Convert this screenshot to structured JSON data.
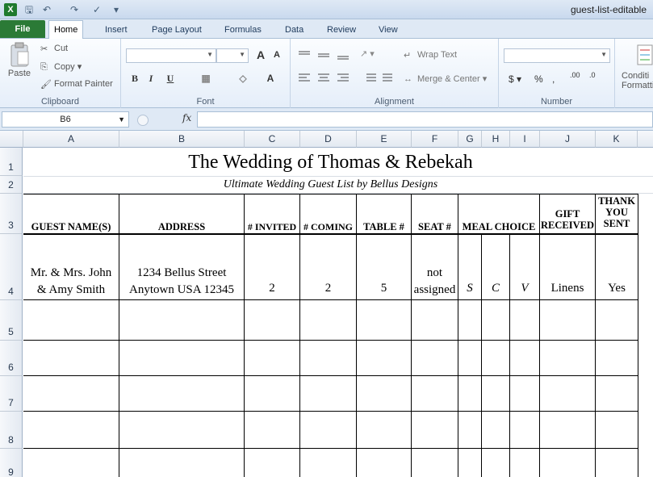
{
  "window": {
    "app_icon": "X",
    "title": "guest-list-editable",
    "quick_access_icons": [
      "save-icon",
      "undo-icon",
      "redo-icon",
      "spellcheck-icon",
      "customize-icon"
    ]
  },
  "tabs": [
    "File",
    "Home",
    "Insert",
    "Page Layout",
    "Formulas",
    "Data",
    "Review",
    "View"
  ],
  "active_tab": "Home",
  "ribbon": {
    "clipboard": {
      "label": "Clipboard",
      "paste": "Paste",
      "cut": "Cut",
      "copy": "Copy",
      "format_painter": "Format Painter"
    },
    "font": {
      "label": "Font",
      "bold": "B",
      "italic": "I",
      "underline": "U",
      "grow": "A",
      "shrink": "A",
      "font_color": "A"
    },
    "alignment": {
      "label": "Alignment",
      "wrap_text": "Wrap Text",
      "merge_center": "Merge & Center"
    },
    "number": {
      "label": "Number",
      "currency": "$",
      "percent": "%",
      "comma": ",",
      "inc_dec": ".00",
      "dec_dec": ".0"
    },
    "styles": {
      "conditional": "Conditi",
      "formatting": "Formatti"
    }
  },
  "formula_bar": {
    "name_box": "B6",
    "fx": "fx",
    "value": ""
  },
  "columns": [
    "A",
    "B",
    "C",
    "D",
    "E",
    "F",
    "G",
    "H",
    "I",
    "J",
    "K"
  ],
  "rows": [
    "1",
    "2",
    "3",
    "4",
    "5",
    "6",
    "7",
    "8",
    "9"
  ],
  "sheet": {
    "title": "The Wedding of Thomas & Rebekah",
    "subtitle": "Ultimate Wedding Guest List by Bellus Designs",
    "headers": {
      "guest": "GUEST NAME(S)",
      "address": "ADDRESS",
      "invited": "# INVITED",
      "coming": "# COMING",
      "table": "TABLE #",
      "seat": "SEAT #",
      "meal": "MEAL CHOICE",
      "gift_line1": "GIFT",
      "gift_line2": "RECEIVED",
      "thank_line1": "THANK",
      "thank_line2": "YOU",
      "thank_line3": "SENT"
    },
    "row4": {
      "guest_line1": "Mr. & Mrs. John",
      "guest_line2": "& Amy Smith",
      "address_line1": "1234 Bellus Street",
      "address_line2": "Anytown USA 12345",
      "invited": "2",
      "coming": "2",
      "table": "5",
      "seat_line1": "not",
      "seat_line2": "assigned",
      "meal_s": "S",
      "meal_c": "C",
      "meal_v": "V",
      "gift": "Linens",
      "thank_you": "Yes"
    }
  }
}
